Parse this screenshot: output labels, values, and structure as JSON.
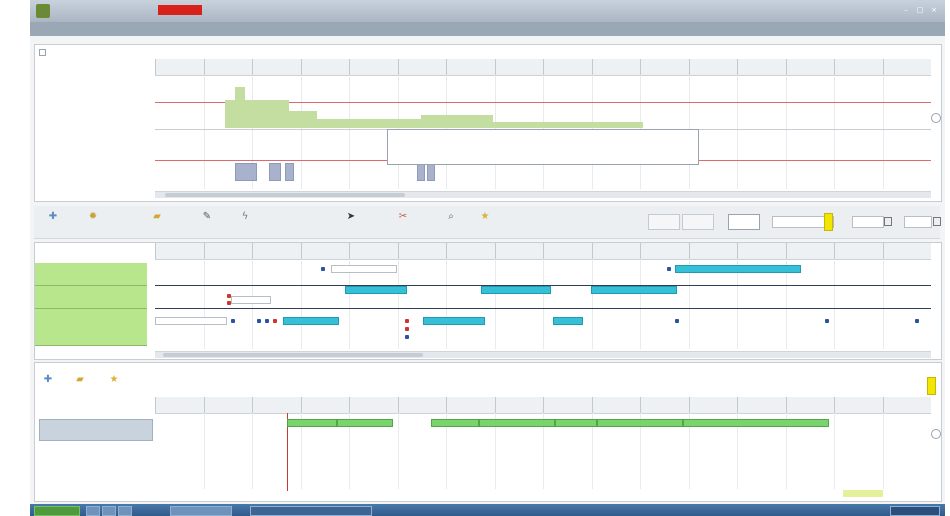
{
  "window": {
    "title": "",
    "highlight_color": "#d8211a",
    "accent": "#35c0d8"
  },
  "menubar": {
    "items": [
      "",
      "",
      "",
      "",
      "",
      "",
      "",
      ""
    ]
  },
  "timeline": {
    "labels": [
      "",
      "",
      "",
      "",
      "",
      "",
      "",
      "",
      "",
      "",
      "",
      "",
      "",
      "",
      "",
      ""
    ]
  },
  "resources": {
    "top_label": "",
    "bottom_label": "",
    "top_y": [
      "",
      "",
      "",
      "",
      ""
    ],
    "bottom_y": [
      "",
      "",
      "",
      "",
      ""
    ]
  },
  "tooltip": {
    "lines": [
      "",
      "",
      ""
    ]
  },
  "toolbar": {
    "icons": [
      "plus-icon",
      "gear-icon",
      "folder-icon",
      "pencil-icon",
      "bolt-icon",
      "cursor-icon",
      "scissor-icon",
      "search-icon",
      "star-icon"
    ],
    "labels": [
      "",
      "",
      "",
      "",
      "",
      "",
      "",
      "",
      ""
    ]
  },
  "filter": {
    "label": "",
    "from_label": "",
    "from_value": "",
    "to_label": "",
    "to_value": ""
  },
  "gantt": {
    "rows": [
      {
        "name": "",
        "sub": ""
      },
      {
        "name": "",
        "sub": ""
      },
      {
        "name": "",
        "sub": ""
      }
    ],
    "tasks": [
      "",
      "",
      "",
      "",
      "",
      "",
      "",
      "",
      "",
      "",
      "",
      "",
      "",
      ""
    ]
  },
  "orders": {
    "section_title": "",
    "tools": [
      "",
      "",
      ""
    ],
    "right_label": "",
    "row_name": "",
    "row_sub": "",
    "bars": [
      "",
      "",
      "",
      "",
      "",
      "",
      "",
      ""
    ]
  },
  "status": {
    "text": "",
    "value": ""
  }
}
